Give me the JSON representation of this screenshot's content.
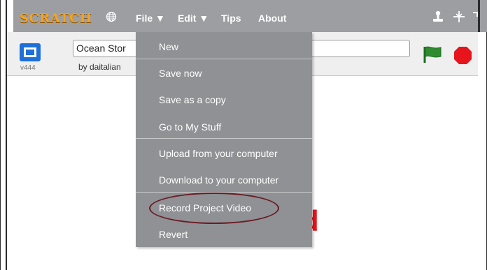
{
  "menubar": {
    "logo": "SCRATCH",
    "items": [
      "File ▼",
      "Edit ▼",
      "Tips",
      "About"
    ]
  },
  "stage": {
    "version": "v444",
    "project_title": "Ocean Stor",
    "byline": "by daitalian",
    "partial_text": "d"
  },
  "file_menu": {
    "items": [
      "New",
      "Save now",
      "Save as a copy",
      "Go to My Stuff",
      "Upload from your computer",
      "Download to your computer",
      "Record Project Video",
      "Revert"
    ]
  },
  "icons": {
    "globe": "globe-icon",
    "stamp": "stamp-icon",
    "shrink": "shrink-icon",
    "fullscreen": "fullscreen-icon",
    "green_flag": "green-flag-icon",
    "stop": "stop-icon"
  },
  "colors": {
    "menubar": "#9c9ea2",
    "dropdown": "#8f9194",
    "logo": "#f7a21c",
    "highlight_oval": "#6b1b24",
    "stage_text": "#e8141b"
  }
}
